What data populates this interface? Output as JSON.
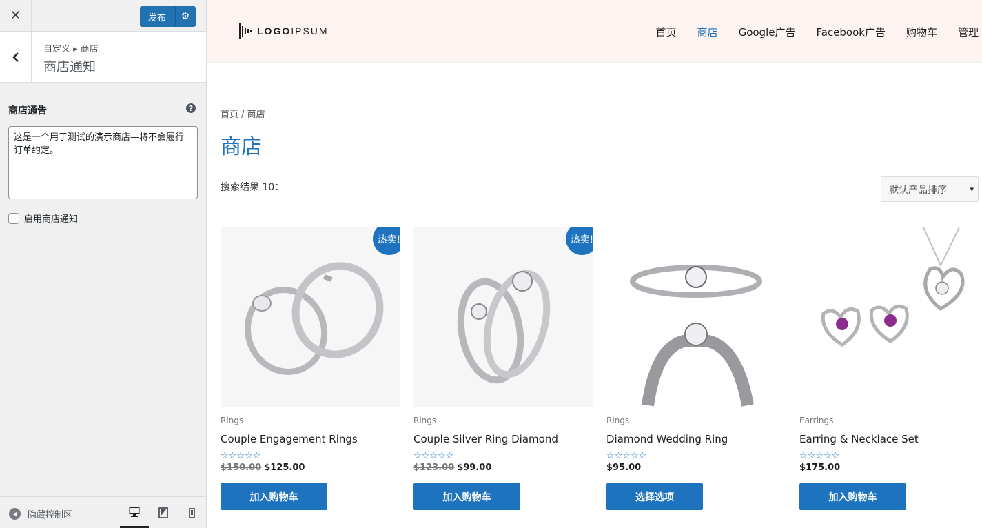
{
  "customizer": {
    "publish_label": "发布",
    "breadcrumb": "自定义 ▸ 商店",
    "section_title": "商店通知",
    "notice_label": "商店通告",
    "help_symbol": "?",
    "notice_text": "这是一个用于测试的演示商店—将不会履行订单约定。",
    "enable_label": "启用商店通知",
    "enable_checked": false,
    "collapse_label": "隐藏控制区",
    "devices": [
      "desktop",
      "tablet",
      "mobile"
    ],
    "active_device": "desktop"
  },
  "site": {
    "logo_text_bold": "LOGO",
    "logo_text": "IPSUM",
    "nav": [
      "首页",
      "商店",
      "Google广告",
      "Facebook广告",
      "购物车",
      "管理"
    ],
    "active_nav": "商店",
    "breadcrumb": "首页 / 商店",
    "page_title": "商店",
    "result_count": "搜索结果 10：",
    "orderby_selected": "默认产品排序",
    "accent_color": "#1e73be",
    "header_bg": "#fdf3f1",
    "products": [
      {
        "badge": "热卖!",
        "category": "Rings",
        "name": "Couple Engagement Rings",
        "old_price": "$150.00",
        "price": "$125.00",
        "rating": 0,
        "button": "加入购物车"
      },
      {
        "badge": "热卖!",
        "category": "Rings",
        "name": "Couple Silver Ring Diamond",
        "old_price": "$123.00",
        "price": "$99.00",
        "rating": 0,
        "button": "加入购物车"
      },
      {
        "badge": "",
        "category": "Rings",
        "name": "Diamond Wedding Ring",
        "old_price": "",
        "price": "$95.00",
        "rating": 0,
        "button": "选择选项"
      },
      {
        "badge": "",
        "category": "Earrings",
        "name": "Earring & Necklace Set",
        "old_price": "",
        "price": "$175.00",
        "rating": 0,
        "button": "加入购物车"
      }
    ]
  }
}
